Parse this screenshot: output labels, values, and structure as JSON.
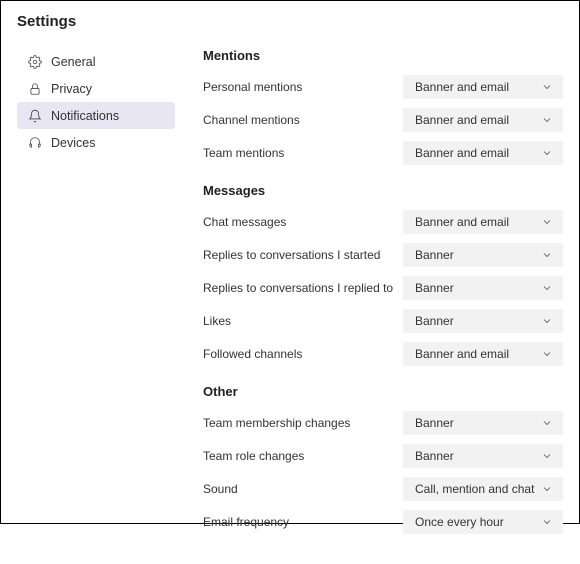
{
  "title": "Settings",
  "sidebar": {
    "items": [
      {
        "label": "General"
      },
      {
        "label": "Privacy"
      },
      {
        "label": "Notifications"
      },
      {
        "label": "Devices"
      }
    ]
  },
  "sections": {
    "mentions": {
      "header": "Mentions",
      "rows": [
        {
          "label": "Personal mentions",
          "value": "Banner and email"
        },
        {
          "label": "Channel mentions",
          "value": "Banner and email"
        },
        {
          "label": "Team mentions",
          "value": "Banner and email"
        }
      ]
    },
    "messages": {
      "header": "Messages",
      "rows": [
        {
          "label": "Chat messages",
          "value": "Banner and email"
        },
        {
          "label": "Replies to conversations I started",
          "value": "Banner"
        },
        {
          "label": "Replies to conversations I replied to",
          "value": "Banner"
        },
        {
          "label": "Likes",
          "value": "Banner"
        },
        {
          "label": "Followed channels",
          "value": "Banner and email"
        }
      ]
    },
    "other": {
      "header": "Other",
      "rows": [
        {
          "label": "Team membership changes",
          "value": "Banner"
        },
        {
          "label": "Team role changes",
          "value": "Banner"
        },
        {
          "label": "Sound",
          "value": "Call, mention and chat"
        },
        {
          "label": "Email frequency",
          "value": "Once every hour"
        }
      ]
    }
  }
}
